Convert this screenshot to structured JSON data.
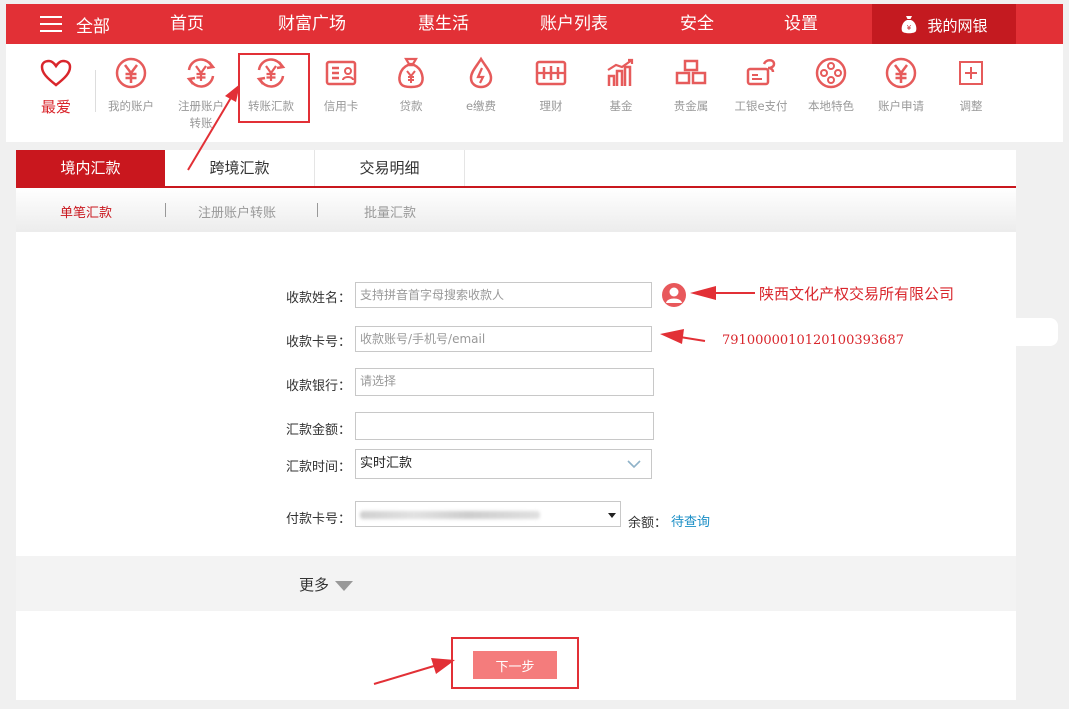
{
  "topnav": {
    "menu_label": "全部",
    "items": [
      "首页",
      "财富广场",
      "惠生活",
      "账户列表",
      "安全",
      "设置"
    ],
    "mybank_label": "我的网银"
  },
  "favorites": {
    "label": "最爱"
  },
  "iconbar": {
    "items": [
      {
        "label": "我的账户",
        "icon": "yuan-circle-icon"
      },
      {
        "label": "注册账户转账",
        "icon": "yuan-cycle-icon"
      },
      {
        "label": "转账汇款",
        "icon": "yuan-cycle-icon"
      },
      {
        "label": "信用卡",
        "icon": "credit-card-icon"
      },
      {
        "label": "贷款",
        "icon": "money-bag-icon"
      },
      {
        "label": "e缴费",
        "icon": "water-drop-icon"
      },
      {
        "label": "理财",
        "icon": "sliders-icon"
      },
      {
        "label": "基金",
        "icon": "growth-chart-icon"
      },
      {
        "label": "贵金属",
        "icon": "gold-bars-icon"
      },
      {
        "label": "工银e支付",
        "icon": "epay-icon"
      },
      {
        "label": "本地特色",
        "icon": "film-reel-icon"
      },
      {
        "label": "账户申请",
        "icon": "yuan-circle-icon"
      },
      {
        "label": "调整",
        "icon": "plus-box-icon"
      }
    ]
  },
  "tabs": [
    "境内汇款",
    "跨境汇款",
    "交易明细"
  ],
  "subtabs": [
    "单笔汇款",
    "注册账户转账",
    "批量汇款"
  ],
  "form": {
    "payee_name_label": "收款姓名：",
    "payee_name_placeholder": "支持拼音首字母搜索收款人",
    "card_label": "收款卡号：",
    "card_placeholder": "收款账号/手机号/email",
    "bank_label": "收款银行：",
    "bank_placeholder": "请选择",
    "amount_label": "汇款金额：",
    "time_label": "汇款时间：",
    "time_value": "实时汇款",
    "pay_card_label": "付款卡号：",
    "balance_label": "余额：",
    "balance_link": "待查询"
  },
  "more_label": "更多",
  "next_label": "下一步",
  "annotations": {
    "payee_name": "陕西文化产权交易所有限公司",
    "card_number": "7910000010120100393687"
  },
  "colors": {
    "brand_red": "#e23036",
    "accent_dark": "#c9171e",
    "link_blue": "#1a8ec6",
    "button_pink": "#f47c7c"
  }
}
